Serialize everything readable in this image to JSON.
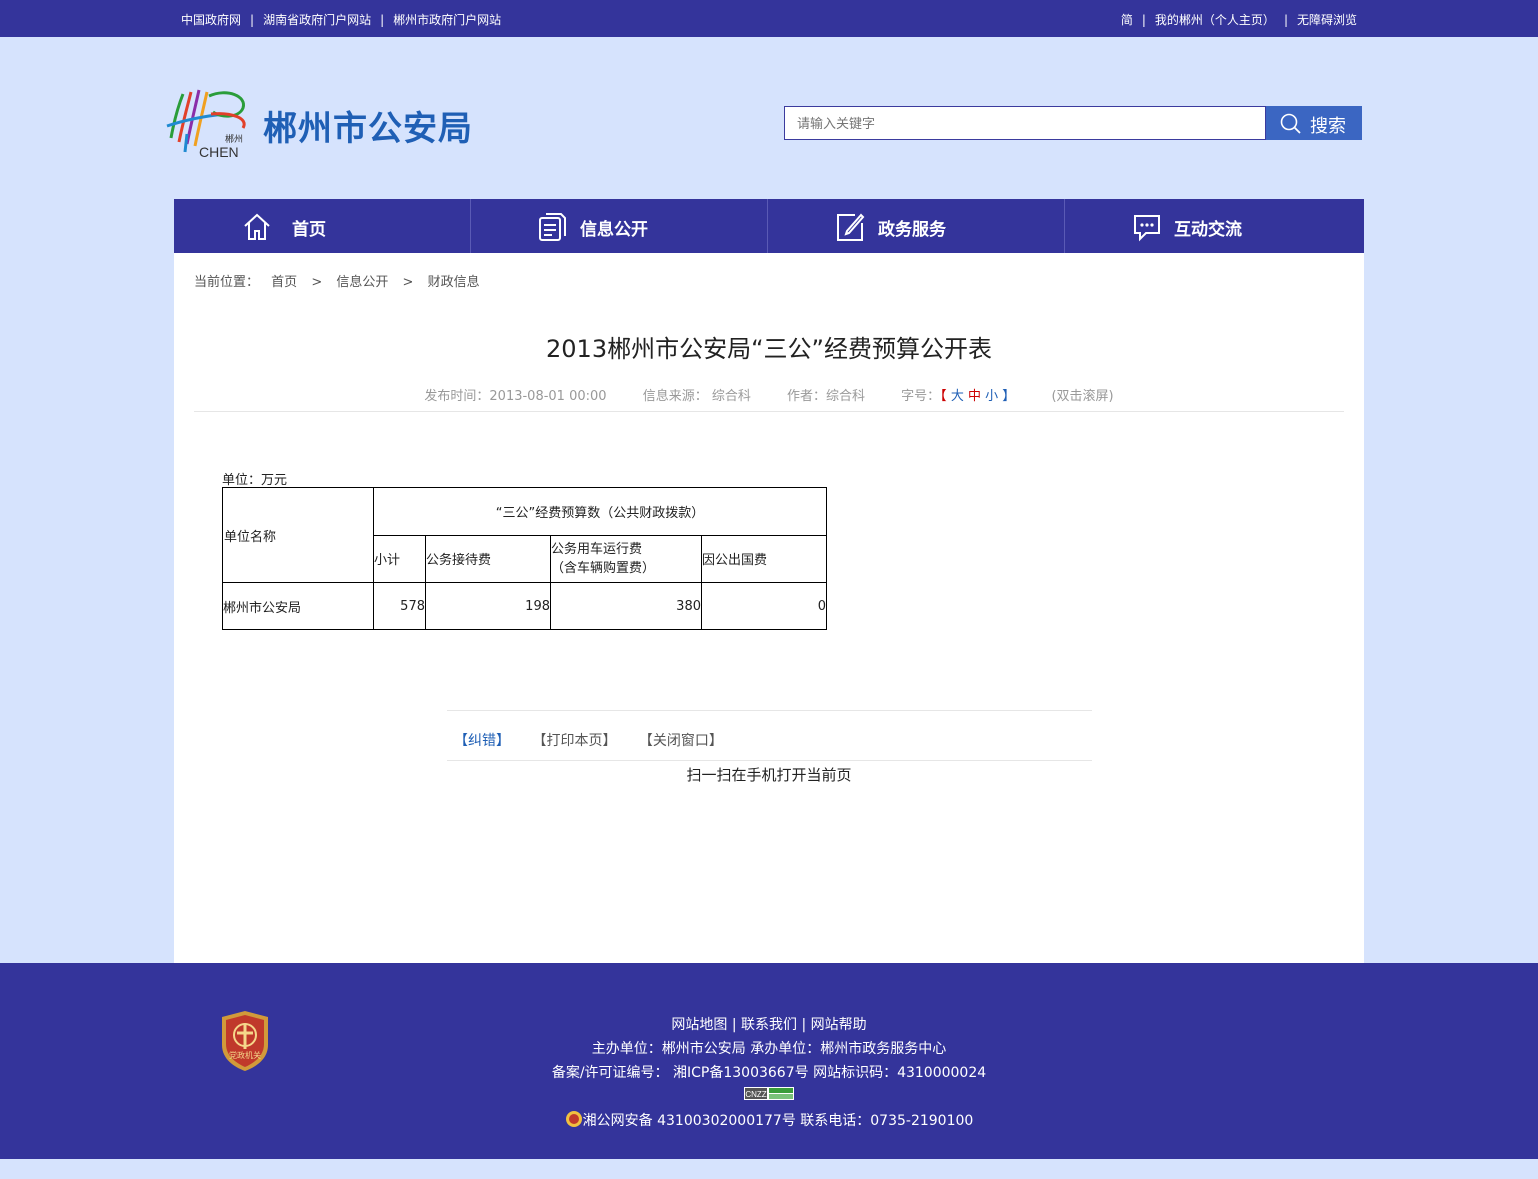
{
  "topbar": {
    "left_links": [
      "中国政府网",
      "湖南省政府门户网站",
      "郴州市政府门户网站"
    ],
    "right_links": [
      "简",
      "我的郴州（个人主页）",
      "无障碍浏览"
    ]
  },
  "header": {
    "logo_text_top": "郴州",
    "logo_text_bottom": "CHEN",
    "site_title": "郴州市公安局",
    "search_placeholder": "请输入关键字",
    "search_button": "搜索"
  },
  "nav": {
    "items": [
      {
        "label": "首页",
        "icon": "home-icon"
      },
      {
        "label": "信息公开",
        "icon": "document-icon"
      },
      {
        "label": "政务服务",
        "icon": "edit-icon"
      },
      {
        "label": "互动交流",
        "icon": "chat-icon"
      }
    ]
  },
  "breadcrumb": {
    "prefix": "当前位置：",
    "items": [
      "首页",
      "信息公开",
      "财政信息"
    ],
    "separator": ">"
  },
  "article": {
    "title": "2013郴州市公安局“三公”经费预算公开表",
    "publish_time": "发布时间：2013-08-01 00:00",
    "source": "信息来源： 综合科",
    "author": "作者：综合科",
    "font_size_label": "字号：",
    "font_size_large": "大",
    "font_size_medium": "中",
    "font_size_small": "小",
    "bracket_open": "【",
    "bracket_close": "】",
    "scroll_hint": "(双击滚屏)",
    "unit": "单位：万元"
  },
  "table": {
    "header_unit_name": "单位名称",
    "header_group": "“三公”经费预算数（公共财政拨款）",
    "columns": [
      "小计",
      "公务接待费",
      "公务用车运行费",
      "（含车辆购置费）",
      "因公出国费"
    ],
    "row": {
      "name": "郴州市公安局",
      "subtotal": "578",
      "reception": "198",
      "vehicle": "380",
      "abroad": "0"
    }
  },
  "actions": {
    "correct": "【纠错】",
    "print": "【打印本页】",
    "close": "【关闭窗口】",
    "qr_hint": "扫一扫在手机打开当前页"
  },
  "footer": {
    "links_line": "网站地图 | 联系我们 | 网站帮助",
    "organizer": "主办单位：郴州市公安局    承办单位：郴州市政务服务中心",
    "license": "备案/许可证编号： 湘ICP备13003667号    网站标识码：4310000024",
    "police_record": "湘公网安备 43100302000177号    联系电话：0735-2190100",
    "badge_text": "党政机关",
    "cnzz_text": "CNZZ"
  },
  "colors": {
    "primary": "#34349b",
    "page_bg": "#d6e3fd",
    "title_blue": "#1f5fb5",
    "search_btn": "#3b66c2"
  }
}
